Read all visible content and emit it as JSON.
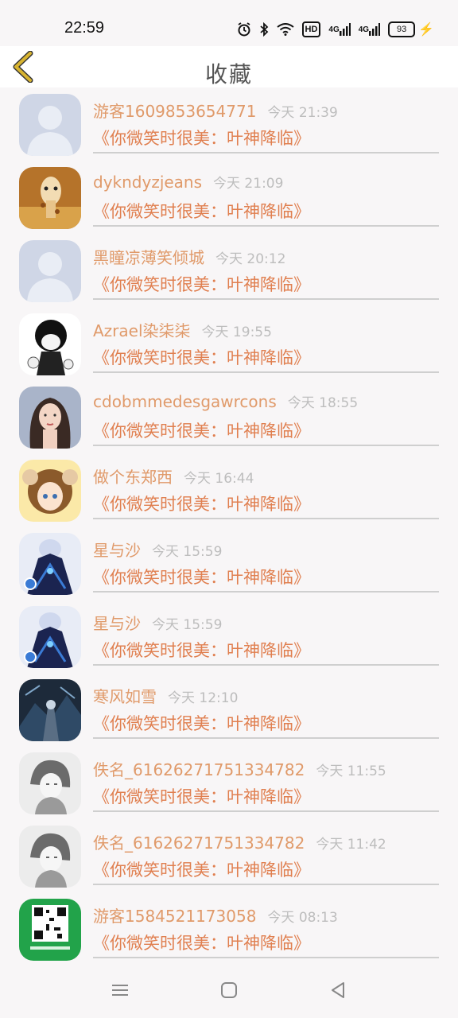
{
  "status_bar": {
    "time": "22:59",
    "hd_label": "HD",
    "sig1": "4G",
    "sig2": "4G",
    "battery": "93"
  },
  "header": {
    "title": "收藏"
  },
  "items": [
    {
      "username": "游客1609853654771",
      "time": "今天 21:39",
      "quote": "《你微笑时很美：叶神降临》",
      "avatar": "avatar-default"
    },
    {
      "username": "dykndyzjeans",
      "time": "今天 21:09",
      "quote": "《你微笑时很美：叶神降临》",
      "avatar": "avatar-giraffe"
    },
    {
      "username": "黑瞳凉薄笑倾城",
      "time": "今天 20:12",
      "quote": "《你微笑时很美：叶神降临》",
      "avatar": "avatar-default"
    },
    {
      "username": "Azrael染柒柒",
      "time": "今天 19:55",
      "quote": "《你微笑时很美：叶神降临》",
      "avatar": "avatar-anime-bw"
    },
    {
      "username": "cdobmmedesgawrcons",
      "time": "今天 18:55",
      "quote": "《你微笑时很美：叶神降临》",
      "avatar": "avatar-portrait"
    },
    {
      "username": "做个东郑西",
      "time": "今天 16:44",
      "quote": "《你微笑时很美：叶神降临》",
      "avatar": "avatar-anime-sheep"
    },
    {
      "username": "星与沙",
      "time": "今天 15:59",
      "quote": "《你微笑时很美：叶神降临》",
      "avatar": "avatar-anime-blue"
    },
    {
      "username": "星与沙",
      "time": "今天 15:59",
      "quote": "《你微笑时很美：叶神降临》",
      "avatar": "avatar-anime-blue"
    },
    {
      "username": "寒风如雪",
      "time": "今天 12:10",
      "quote": "《你微笑时很美：叶神降临》",
      "avatar": "avatar-anime-dark"
    },
    {
      "username": "佚名_61626271751334782",
      "time": "今天 11:55",
      "quote": "《你微笑时很美：叶神降临》",
      "avatar": "avatar-sketch"
    },
    {
      "username": "佚名_61626271751334782",
      "time": "今天 11:42",
      "quote": "《你微笑时很美：叶神降临》",
      "avatar": "avatar-sketch"
    },
    {
      "username": "游客1584521173058",
      "time": "今天 08:13",
      "quote": "《你微笑时很美：叶神降临》",
      "avatar": "avatar-qr-green"
    }
  ],
  "colors": {
    "username": "#e09a6a",
    "quote": "#e07f4f",
    "timestamp": "#bdbdbd",
    "back_arrow": "#d8b431"
  },
  "nav": {
    "icons": [
      "menu-icon",
      "home-square-icon",
      "back-triangle-icon"
    ]
  }
}
